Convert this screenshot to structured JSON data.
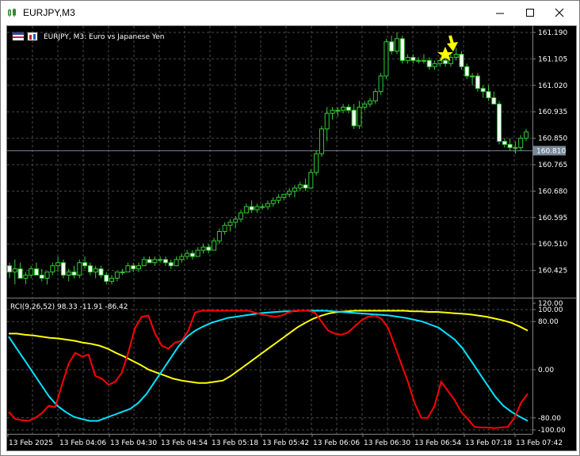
{
  "window": {
    "title": "EURJPY,M3"
  },
  "chart_header": {
    "symbol_label": "EURJPY, M3:  Euro vs Japanese Yen"
  },
  "indicator": {
    "label": "RCI(9,26,52) 98.33 -11.91 -86.42"
  },
  "price_axis": {
    "ticks": [
      "161.190",
      "161.105",
      "161.020",
      "160.935",
      "160.850",
      "160.765",
      "160.680",
      "160.595",
      "160.510",
      "160.425"
    ],
    "current_price": "160.810"
  },
  "indicator_axis": {
    "ticks": [
      "120.00",
      "100.00",
      "80.00",
      "0.00",
      "-80.00",
      "-100.00"
    ]
  },
  "time_axis": {
    "labels": [
      "13 Feb 2025",
      "13 Feb 04:06",
      "13 Feb 04:30",
      "13 Feb 04:54",
      "13 Feb 05:18",
      "13 Feb 05:42",
      "13 Feb 06:06",
      "13 Feb 06:30",
      "13 Feb 06:54",
      "13 Feb 07:18",
      "13 Feb 07:42"
    ]
  },
  "colors": {
    "background": "#000000",
    "grid": "#4a4a4a",
    "candle": "#32cd32",
    "bull_body": "#000000",
    "bear_body": "#ffffff",
    "rci_short": "#ff0000",
    "rci_middle": "#00e5ff",
    "rci_long": "#ffff00",
    "bid_line": "#778899",
    "signal_arrow": "#ffff00"
  },
  "chart_data": {
    "type": "candlestick",
    "ylim": [
      160.38,
      161.23
    ],
    "candles": [
      [
        160.44,
        160.45,
        160.4,
        160.42
      ],
      [
        160.42,
        160.46,
        160.38,
        160.43
      ],
      [
        160.43,
        160.45,
        160.4,
        160.4
      ],
      [
        160.4,
        160.42,
        160.38,
        160.41
      ],
      [
        160.41,
        160.44,
        160.4,
        160.43
      ],
      [
        160.43,
        160.45,
        160.41,
        160.41
      ],
      [
        160.41,
        160.43,
        160.39,
        160.4
      ],
      [
        160.4,
        160.42,
        160.38,
        160.42
      ],
      [
        160.42,
        160.45,
        160.41,
        160.44
      ],
      [
        160.44,
        160.47,
        160.42,
        160.45
      ],
      [
        160.45,
        160.46,
        160.4,
        160.41
      ],
      [
        160.41,
        160.43,
        160.39,
        160.42
      ],
      [
        160.42,
        160.44,
        160.4,
        160.41
      ],
      [
        160.41,
        160.46,
        160.4,
        160.45
      ],
      [
        160.45,
        160.47,
        160.43,
        160.44
      ],
      [
        160.44,
        160.45,
        160.41,
        160.42
      ],
      [
        160.42,
        160.44,
        160.4,
        160.43
      ],
      [
        160.43,
        160.44,
        160.4,
        160.41
      ],
      [
        160.41,
        160.42,
        160.38,
        160.39
      ],
      [
        160.39,
        160.41,
        160.38,
        160.4
      ],
      [
        160.4,
        160.42,
        160.39,
        160.42
      ],
      [
        160.42,
        160.43,
        160.41,
        160.42
      ],
      [
        160.42,
        160.45,
        160.42,
        160.44
      ],
      [
        160.44,
        160.45,
        160.42,
        160.43
      ],
      [
        160.43,
        160.45,
        160.42,
        160.44
      ],
      [
        160.44,
        160.47,
        160.44,
        160.46
      ],
      [
        160.46,
        160.47,
        160.45,
        160.45
      ],
      [
        160.45,
        160.47,
        160.44,
        160.46
      ],
      [
        160.46,
        160.47,
        160.45,
        160.46
      ],
      [
        160.46,
        160.47,
        160.44,
        160.45
      ],
      [
        160.45,
        160.46,
        160.43,
        160.44
      ],
      [
        160.44,
        160.47,
        160.44,
        160.46
      ],
      [
        160.46,
        160.48,
        160.45,
        160.47
      ],
      [
        160.47,
        160.49,
        160.46,
        160.48
      ],
      [
        160.48,
        160.49,
        160.46,
        160.47
      ],
      [
        160.47,
        160.5,
        160.47,
        160.49
      ],
      [
        160.49,
        160.51,
        160.48,
        160.5
      ],
      [
        160.5,
        160.51,
        160.48,
        160.49
      ],
      [
        160.49,
        160.53,
        160.49,
        160.52
      ],
      [
        160.52,
        160.56,
        160.51,
        160.55
      ],
      [
        160.55,
        160.58,
        160.54,
        160.57
      ],
      [
        160.57,
        160.59,
        160.55,
        160.58
      ],
      [
        160.58,
        160.6,
        160.56,
        160.59
      ],
      [
        160.59,
        160.62,
        160.58,
        160.61
      ],
      [
        160.61,
        160.64,
        160.61,
        160.63
      ],
      [
        160.63,
        160.65,
        160.61,
        160.62
      ],
      [
        160.62,
        160.64,
        160.61,
        160.63
      ],
      [
        160.63,
        160.64,
        160.62,
        160.63
      ],
      [
        160.63,
        160.65,
        160.62,
        160.64
      ],
      [
        160.64,
        160.66,
        160.63,
        160.65
      ],
      [
        160.65,
        160.67,
        160.64,
        160.66
      ],
      [
        160.66,
        160.67,
        160.65,
        160.67
      ],
      [
        160.67,
        160.69,
        160.66,
        160.68
      ],
      [
        160.68,
        160.7,
        160.66,
        160.69
      ],
      [
        160.69,
        160.71,
        160.68,
        160.7
      ],
      [
        160.7,
        160.72,
        160.68,
        160.69
      ],
      [
        160.69,
        160.75,
        160.69,
        160.74
      ],
      [
        160.74,
        160.81,
        160.73,
        160.8
      ],
      [
        160.8,
        160.89,
        160.79,
        160.88
      ],
      [
        160.88,
        160.95,
        160.84,
        160.93
      ],
      [
        160.93,
        160.95,
        160.91,
        160.94
      ],
      [
        160.94,
        160.95,
        160.92,
        160.94
      ],
      [
        160.94,
        160.96,
        160.93,
        160.95
      ],
      [
        160.95,
        160.96,
        160.93,
        160.94
      ],
      [
        160.94,
        160.96,
        160.88,
        160.89
      ],
      [
        160.89,
        160.97,
        160.88,
        160.95
      ],
      [
        160.95,
        160.97,
        160.94,
        160.96
      ],
      [
        160.96,
        160.98,
        160.95,
        160.97
      ],
      [
        160.97,
        161.01,
        160.96,
        161.0
      ],
      [
        161.0,
        161.06,
        160.99,
        161.05
      ],
      [
        161.05,
        161.17,
        161.04,
        161.16
      ],
      [
        161.16,
        161.18,
        161.12,
        161.13
      ],
      [
        161.13,
        161.19,
        161.12,
        161.17
      ],
      [
        161.17,
        161.18,
        161.09,
        161.1
      ],
      [
        161.1,
        161.12,
        161.09,
        161.11
      ],
      [
        161.11,
        161.12,
        161.09,
        161.1
      ],
      [
        161.1,
        161.11,
        161.09,
        161.1
      ],
      [
        161.1,
        161.12,
        161.09,
        161.1
      ],
      [
        161.1,
        161.11,
        161.07,
        161.08
      ],
      [
        161.08,
        161.1,
        161.07,
        161.09
      ],
      [
        161.09,
        161.11,
        161.08,
        161.1
      ],
      [
        161.1,
        161.11,
        161.08,
        161.09
      ],
      [
        161.09,
        161.12,
        161.08,
        161.11
      ],
      [
        161.11,
        161.14,
        161.1,
        161.12
      ],
      [
        161.12,
        161.13,
        161.07,
        161.08
      ],
      [
        161.08,
        161.09,
        161.04,
        161.05
      ],
      [
        161.05,
        161.06,
        161.02,
        161.05
      ],
      [
        161.05,
        161.06,
        161.0,
        161.01
      ],
      [
        161.01,
        161.02,
        160.98,
        161.0
      ],
      [
        161.0,
        161.02,
        160.97,
        160.98
      ],
      [
        160.98,
        161.0,
        160.96,
        160.96
      ],
      [
        160.96,
        160.97,
        160.83,
        160.84
      ],
      [
        160.84,
        160.85,
        160.82,
        160.83
      ],
      [
        160.83,
        160.85,
        160.81,
        160.82
      ],
      [
        160.82,
        160.84,
        160.8,
        160.82
      ],
      [
        160.82,
        160.86,
        160.81,
        160.85
      ],
      [
        160.85,
        160.88,
        160.84,
        160.87
      ]
    ],
    "rci": {
      "ylim": [
        -110,
        125
      ],
      "short": [
        -70,
        -82,
        -84,
        -85,
        -80,
        -72,
        -60,
        -62,
        -25,
        10,
        28,
        22,
        25,
        -10,
        -15,
        -25,
        -20,
        -5,
        30,
        70,
        88,
        90,
        60,
        40,
        35,
        45,
        48,
        65,
        95,
        98,
        98,
        98,
        98,
        98,
        98,
        98,
        98,
        95,
        92,
        90,
        88,
        90,
        95,
        98,
        98,
        98,
        95,
        80,
        65,
        60,
        58,
        62,
        72,
        82,
        88,
        90,
        85,
        70,
        40,
        10,
        -20,
        -55,
        -80,
        -80,
        -60,
        -20,
        -35,
        -50,
        -70,
        -82,
        -95,
        -96,
        -96,
        -97,
        -96,
        -95,
        -80,
        -55,
        -40
      ],
      "middle": [
        55,
        35,
        15,
        -5,
        -25,
        -45,
        -60,
        -70,
        -78,
        -82,
        -85,
        -85,
        -80,
        -75,
        -70,
        -65,
        -55,
        -40,
        -20,
        0,
        20,
        40,
        55,
        65,
        72,
        78,
        82,
        86,
        88,
        90,
        92,
        94,
        95,
        96,
        97,
        97,
        98,
        98,
        98,
        98,
        97,
        96,
        95,
        94,
        93,
        92,
        91,
        90,
        88,
        86,
        83,
        80,
        75,
        70,
        60,
        50,
        35,
        15,
        -5,
        -25,
        -45,
        -60,
        -70,
        -78,
        -85
      ],
      "long": [
        60,
        60,
        58,
        57,
        55,
        53,
        52,
        50,
        48,
        45,
        43,
        40,
        35,
        28,
        22,
        15,
        8,
        0,
        -5,
        -10,
        -15,
        -18,
        -20,
        -22,
        -22,
        -20,
        -18,
        -10,
        0,
        10,
        20,
        30,
        40,
        50,
        60,
        70,
        78,
        85,
        90,
        94,
        96,
        97,
        98,
        98,
        98,
        98,
        98,
        98,
        98,
        97,
        97,
        96,
        96,
        95,
        94,
        93,
        92,
        90,
        88,
        85,
        82,
        78,
        72,
        65
      ]
    }
  }
}
